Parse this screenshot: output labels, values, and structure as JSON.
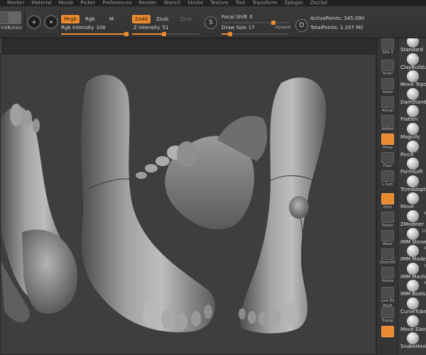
{
  "menu": [
    "Marker",
    "Material",
    "Movie",
    "Picker",
    "Preferences",
    "Render",
    "Stencil",
    "Stroke",
    "Texture",
    "Tool",
    "Transform",
    "Zplugin",
    "Zscript"
  ],
  "shelf": {
    "tools": [
      {
        "label": "Edit",
        "icon": "edit-icon"
      },
      {
        "label": "Rotate",
        "icon": "rotate-icon"
      }
    ],
    "mrgb": "Mrgb",
    "rgb": "Rgb",
    "m": "M",
    "zadd": "Zadd",
    "zsub": "Zsub",
    "zcut": "Zcut",
    "rgb_intensity_label": "Rgb Intensity",
    "rgb_intensity_value": "100",
    "rgb_intensity": 1.0,
    "z_intensity_label": "Z Intensity",
    "z_intensity_value": "51",
    "z_intensity": 0.51,
    "s_button": "S",
    "focal_shift_label": "Focal Shift",
    "focal_shift_value": "0",
    "draw_size_label": "Draw Size",
    "draw_size_value": "17",
    "dynamic": "Dynamic",
    "d_button": "D",
    "active_points": "ActivePoints: 345,090",
    "total_points": "TotalPoints: 1.357 Mil"
  },
  "right_tools": [
    {
      "label": "Scroll",
      "icon": "hand-icon"
    },
    {
      "label": "Zoom",
      "icon": "magnifier-icon"
    },
    {
      "label": "Actual",
      "icon": "actual-icon"
    },
    {
      "label": "AAHalf",
      "icon": "aahalf-icon"
    },
    {
      "label": "Persp",
      "icon": "perspective-icon",
      "active": true
    },
    {
      "label": "Floor",
      "icon": "floor-icon"
    },
    {
      "label": "L.Sym",
      "icon": "local-symmetry-icon"
    },
    {
      "label": "Qxyz",
      "icon": "axis-icon",
      "active": true
    },
    {
      "label": "Frame",
      "icon": "frame-icon"
    },
    {
      "label": "Move",
      "icon": "move-icon"
    },
    {
      "label": "Zoom3D",
      "icon": "zoom3d-icon"
    },
    {
      "label": "Rotate",
      "icon": "rotate3d-icon"
    },
    {
      "label": "Line Fill PolyF",
      "icon": "polyframe-icon"
    },
    {
      "label": "Transp",
      "icon": "transparency-icon"
    },
    {
      "label": "",
      "icon": "solo-icon",
      "active": true
    }
  ],
  "spix": "SPix 3",
  "brushes": [
    {
      "name": "Standard"
    },
    {
      "name": "ClayBuildup"
    },
    {
      "name": "Move Topological"
    },
    {
      "name": "DamStandard"
    },
    {
      "name": "Flatten"
    },
    {
      "name": "Magnify"
    },
    {
      "name": "Pinch"
    },
    {
      "name": "FormSoft"
    },
    {
      "name": "TrimAdaptive"
    },
    {
      "name": "Move"
    },
    {
      "name": "ZModeler",
      "num": "4"
    },
    {
      "name": "IMM SteamG",
      "num": "12"
    },
    {
      "name": "IMM ModelKit",
      "num": "4"
    },
    {
      "name": "IMM Machine",
      "num": "2"
    },
    {
      "name": "IMM Bools",
      "num": "4"
    },
    {
      "name": "CurveTube"
    },
    {
      "name": "Move Elastic"
    },
    {
      "name": "SnakeHook"
    }
  ]
}
